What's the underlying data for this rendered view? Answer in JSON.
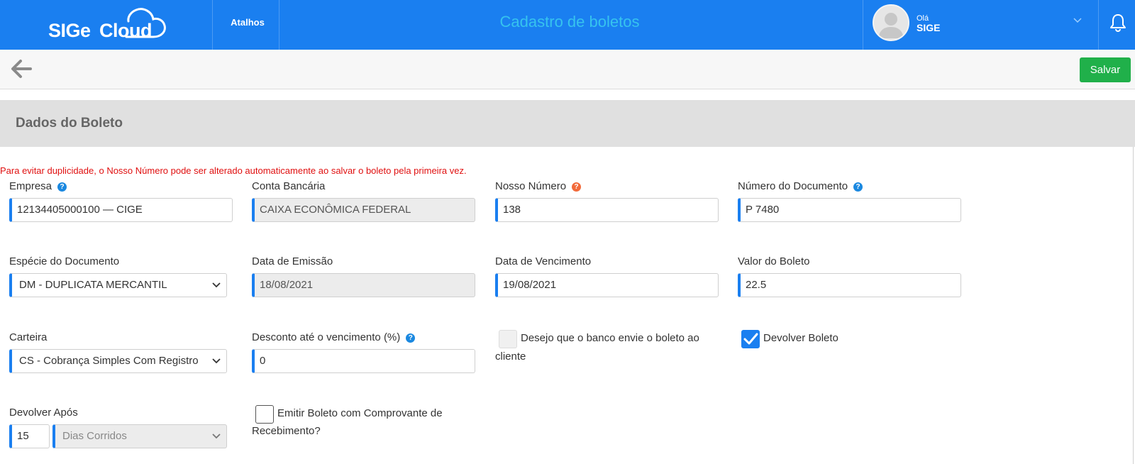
{
  "header": {
    "logo_part1": "SIGe",
    "logo_part2": "Cloud",
    "shortcuts_label": "Atalhos",
    "page_title": "Cadastro de boletos",
    "greeting": "Olá",
    "user_name": "SIGE"
  },
  "toolbar": {
    "save_label": "Salvar"
  },
  "section": {
    "title": "Dados do Boleto"
  },
  "warning": "Para evitar duplicidade, o Nosso Número pode ser alterado automaticamente ao salvar o boleto pela primeira vez.",
  "form": {
    "empresa": {
      "label": "Empresa",
      "value": "12134405000100 — CIGE"
    },
    "conta_bancaria": {
      "label": "Conta Bancária",
      "value": "CAIXA ECONÔMICA FEDERAL"
    },
    "nosso_numero": {
      "label": "Nosso Número",
      "value": "138"
    },
    "numero_documento": {
      "label": "Número do Documento",
      "value": "P 7480"
    },
    "especie_documento": {
      "label": "Espécie do Documento",
      "value": "DM - DUPLICATA MERCANTIL"
    },
    "data_emissao": {
      "label": "Data de Emissão",
      "value": "18/08/2021"
    },
    "data_vencimento": {
      "label": "Data de Vencimento",
      "value": "19/08/2021"
    },
    "valor_boleto": {
      "label": "Valor do Boleto",
      "value": "22.5"
    },
    "carteira": {
      "label": "Carteira",
      "value": "CS - Cobrança Simples Com Registro"
    },
    "desconto": {
      "label": "Desconto até o vencimento (%)",
      "value": "0"
    },
    "banco_envia": {
      "label_line1": "Desejo que o banco envie o boleto ao",
      "label_line2": "cliente",
      "checked": false
    },
    "devolver_boleto": {
      "label": "Devolver Boleto",
      "checked": true
    },
    "devolver_apos": {
      "label": "Devolver Após",
      "value": "15",
      "unit": "Dias Corridos"
    },
    "comprovante": {
      "label_line1": "Emitir Boleto com Comprovante de",
      "label_line2": "Recebimento?",
      "checked": false
    }
  },
  "icons": {
    "help": "?",
    "back": "arrow-left-icon",
    "bell": "bell-icon",
    "chevron": "chevron-down-icon"
  },
  "colors": {
    "header_bg": "#1a7ff0",
    "title": "#36c3ee",
    "save": "#20b04a",
    "warning": "#e01010"
  }
}
